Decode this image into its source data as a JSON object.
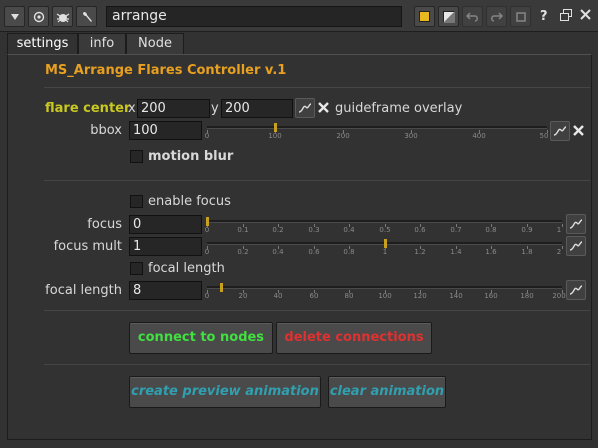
{
  "window": {
    "name_value": "arrange",
    "help_label": "?"
  },
  "tabs": [
    {
      "label": "settings"
    },
    {
      "label": "info"
    },
    {
      "label": "Node"
    }
  ],
  "panel": {
    "title": "MS_Arrange Flares Controller v.1",
    "title_color": "#e8a020",
    "flare_center": {
      "label": "flare center",
      "x_label": "x",
      "x_value": "200",
      "y_label": "y",
      "y_value": "200",
      "guideframe_label": "guideframe overlay"
    },
    "bbox": {
      "label": "bbox",
      "value": "100",
      "ticks": [
        "0",
        "100",
        "200",
        "300",
        "400",
        "50"
      ],
      "level": 100,
      "range": [
        0,
        500
      ]
    },
    "motion_blur": {
      "label": "motion blur",
      "checked": false
    },
    "enable_focus": {
      "label": "enable focus",
      "checked": false
    },
    "focus": {
      "label": "focus",
      "value": "0",
      "ticks": [
        "0",
        "0.1",
        "0.2",
        "0.3",
        "0.4",
        "0.5",
        "0.6",
        "0.7",
        "0.8",
        "0.9",
        "1"
      ],
      "level": 0,
      "range": [
        0,
        1
      ]
    },
    "focus_mult": {
      "label": "focus mult",
      "value": "1",
      "ticks": [
        "0",
        "0.2",
        "0.4",
        "0.6",
        "0.8",
        "1",
        "1.2",
        "1.4",
        "1.6",
        "1.8",
        "2"
      ],
      "level": 1,
      "range": [
        0,
        2
      ]
    },
    "focal_length_toggle": {
      "label": "focal length",
      "checked": false
    },
    "focal_length": {
      "label": "focal length",
      "value": "8",
      "ticks": [
        "0",
        "20",
        "40",
        "60",
        "80",
        "100",
        "120",
        "140",
        "160",
        "180",
        "200"
      ],
      "level": 8,
      "range": [
        0,
        200
      ]
    },
    "buttons": {
      "connect": {
        "label": "connect to nodes",
        "color": "#40e040"
      },
      "delete": {
        "label": "delete connections",
        "color": "#e03030"
      },
      "create_preview": {
        "label": "create preview animation",
        "color": "#30a0b0"
      },
      "clear": {
        "label": "clear animation",
        "color": "#30a0b0"
      }
    },
    "label_accent": "#c8c820"
  }
}
